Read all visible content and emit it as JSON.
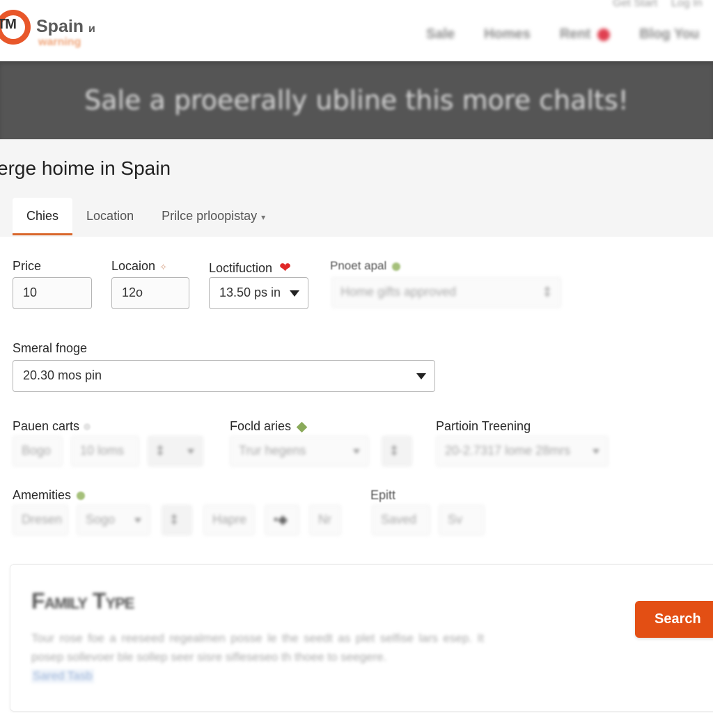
{
  "header": {
    "logo_glyph": "TM",
    "brand_name": "Spain",
    "brand_suffix": "и",
    "brand_tagline": "warning",
    "utility_nav": [
      "Get Start",
      "Log In"
    ],
    "main_nav": [
      {
        "label": "Sale"
      },
      {
        "label": "Homes"
      },
      {
        "label": "Rent",
        "has_badge": true
      },
      {
        "label": "Blog You"
      }
    ],
    "badge_color": "#e04050"
  },
  "banner": {
    "text": "Sale a proeerally ubline this more chalts!"
  },
  "page": {
    "title": "erge hoime in Spain"
  },
  "tabs": [
    {
      "label": "Chies",
      "active": true
    },
    {
      "label": "Location",
      "active": false
    },
    {
      "label": "Prilce prloopistay",
      "active": false,
      "has_dropdown": true,
      "caret": "▾"
    }
  ],
  "form": {
    "price": {
      "label": "Price",
      "value": "10"
    },
    "location": {
      "label": "Locaion",
      "value": "12o",
      "indicator": "✧"
    },
    "loctifuction": {
      "label": "Loctifuction",
      "value": "13.50 pѕ in",
      "indicator": "❤"
    },
    "property_appeal": {
      "label": "Pnoet apal",
      "placeholder": "Home gifts approved",
      "icon_glyph": "‡"
    },
    "smeral_fnoge": {
      "label": "Smeral fnoge",
      "value": "20.30 mos pin"
    },
    "pauen_carts": {
      "label": "Pauen carts",
      "chips": [
        "Bogo",
        "10 loms",
        "‡"
      ],
      "dropdown_caret": "▾"
    },
    "focld_aries": {
      "label": "Focld aries",
      "select_value": "Trur hegens",
      "icon_glyph": "‡"
    },
    "partioin_treening": {
      "label": "Partioin Treening",
      "select_value": "20-2.7317 lome 28mrs"
    },
    "amenities": {
      "label": "Amemities",
      "chips": [
        "Dresen",
        "Sogo",
        "‡",
        "Hapre",
        "•◆",
        "Nr"
      ]
    },
    "epitt": {
      "label": "Epitt",
      "chips": [
        "Saved",
        "Sv"
      ]
    }
  },
  "card": {
    "title": "Family Type",
    "body": "Tour rose foe a reeseed regealmen posse le the seedt as plet selfise lars esep. It posep sollevoer ble sollep seer sisre sifleseseo th thoee to seegere.",
    "link": "Sared Tasb"
  },
  "actions": {
    "search_label": "Search"
  },
  "colors": {
    "accent": "#e34f14",
    "tab_underline": "#d9672c",
    "banner_bg": "#555555",
    "logo": "#e8572a"
  }
}
